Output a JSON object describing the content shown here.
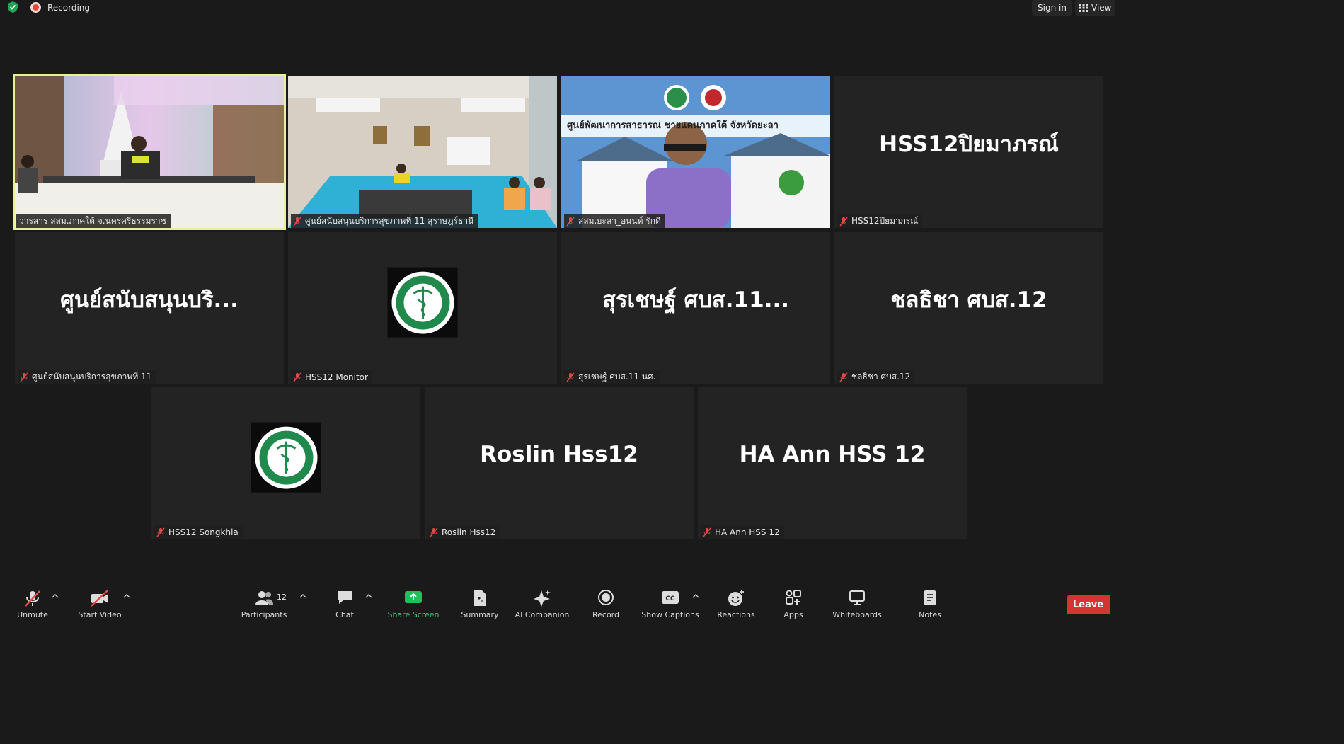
{
  "topbar": {
    "recording_label": "Recording",
    "signin_label": "Sign in",
    "view_label": "View"
  },
  "tiles": [
    {
      "name": "วารสาร สสม.ภาคใต้ จ.นครศรีธรรมราช",
      "big": ""
    },
    {
      "name": "ศูนย์สนับสนุนบริการสุขภาพที่ 11 สุราษฎร์ธานี",
      "big": ""
    },
    {
      "name": "สสม.ยะลา_อนนท์ รักดี",
      "big": "",
      "banner": "ศูนย์พัฒนาการสาธารณ ชายแดนภาคใต้ จังหวัดยะลา"
    },
    {
      "name": "HSS12ปิยมาภรณ์",
      "big": "HSS12ปิยมาภรณ์"
    },
    {
      "name": "ศูนย์สนับสนุนบริการสุขภาพที่ 11",
      "big": "ศูนย์สนับสนุนบริ..."
    },
    {
      "name": "HSS12 Monitor",
      "big": ""
    },
    {
      "name": "สุรเชษฐ์ ศบส.11 นศ.",
      "big": "สุรเชษฐ์ ศบส.11..."
    },
    {
      "name": "ชลธิชา ศบส.12",
      "big": "ชลธิชา ศบส.12"
    },
    {
      "name": "HSS12 Songkhla",
      "big": ""
    },
    {
      "name": "Roslin Hss12",
      "big": "Roslin Hss12"
    },
    {
      "name": "HA Ann HSS 12",
      "big": "HA Ann HSS 12"
    }
  ],
  "toolbar": {
    "unmute": "Unmute",
    "start_video": "Start Video",
    "participants": "Participants",
    "participant_count": "12",
    "chat": "Chat",
    "share_screen": "Share Screen",
    "summary": "Summary",
    "ai_companion": "AI Companion",
    "record": "Record",
    "show_captions": "Show Captions",
    "reactions": "Reactions",
    "apps": "Apps",
    "whiteboards": "Whiteboards",
    "notes": "Notes",
    "leave": "Leave"
  },
  "colors": {
    "active_speaker": "#e7f09a",
    "leave": "#d63333",
    "share": "#2ecc71"
  }
}
